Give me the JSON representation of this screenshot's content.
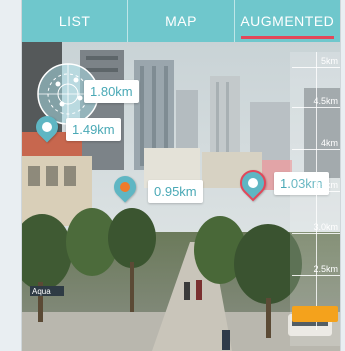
{
  "tabs": [
    {
      "label": "LIST"
    },
    {
      "label": "MAP"
    },
    {
      "label": "AUGMENTED",
      "active": true
    }
  ],
  "markers": [
    {
      "distance": "1.80km",
      "pin_style": "radar-cluster"
    },
    {
      "distance": "1.49km",
      "pin_style": "teal"
    },
    {
      "distance": "0.95km",
      "pin_style": "orange"
    },
    {
      "distance": "1.03km",
      "pin_style": "teal-active"
    }
  ],
  "range_scale": {
    "ticks": [
      "5km",
      "4.5km",
      "4km",
      "3.5km",
      "3.0km",
      "2.5km"
    ]
  },
  "scene_sign": "Aqua",
  "colors": {
    "tab_bar": "#6fc7cc",
    "active_underline": "#e2475a",
    "marker_teal": "#5fb6c3",
    "marker_orange": "#f07b2b",
    "slider_handle": "#f4a21c"
  }
}
